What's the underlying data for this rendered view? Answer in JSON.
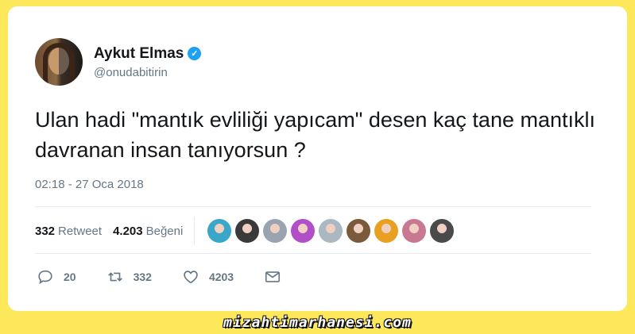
{
  "user": {
    "display_name": "Aykut Elmas",
    "handle": "@onudabitirin",
    "verified": true
  },
  "tweet": {
    "text": "Ulan hadi \"mantık evliliği yapıcam\" desen kaç tane mantıklı davranan insan tanıyorsun ?",
    "timestamp": "02:18 - 27 Oca 2018"
  },
  "stats": {
    "retweets_count": "332",
    "retweets_label": "Retweet",
    "likes_count": "4.203",
    "likes_label": "Beğeni"
  },
  "likers": [
    {
      "color": "#3aa7c9"
    },
    {
      "color": "#3a3a3a"
    },
    {
      "color": "#9aa4b0"
    },
    {
      "color": "#b04fc8"
    },
    {
      "color": "#aab8c2"
    },
    {
      "color": "#7a5a3a"
    },
    {
      "color": "#e8a020"
    },
    {
      "color": "#c87890"
    },
    {
      "color": "#4a4a4a"
    }
  ],
  "actions": {
    "reply_count": "20",
    "retweet_count": "332",
    "like_count": "4203"
  },
  "watermark": "mizahtimarhanesi.com",
  "colors": {
    "background": "#fce85a",
    "verified_blue": "#1da1f2",
    "muted_text": "#657786"
  }
}
